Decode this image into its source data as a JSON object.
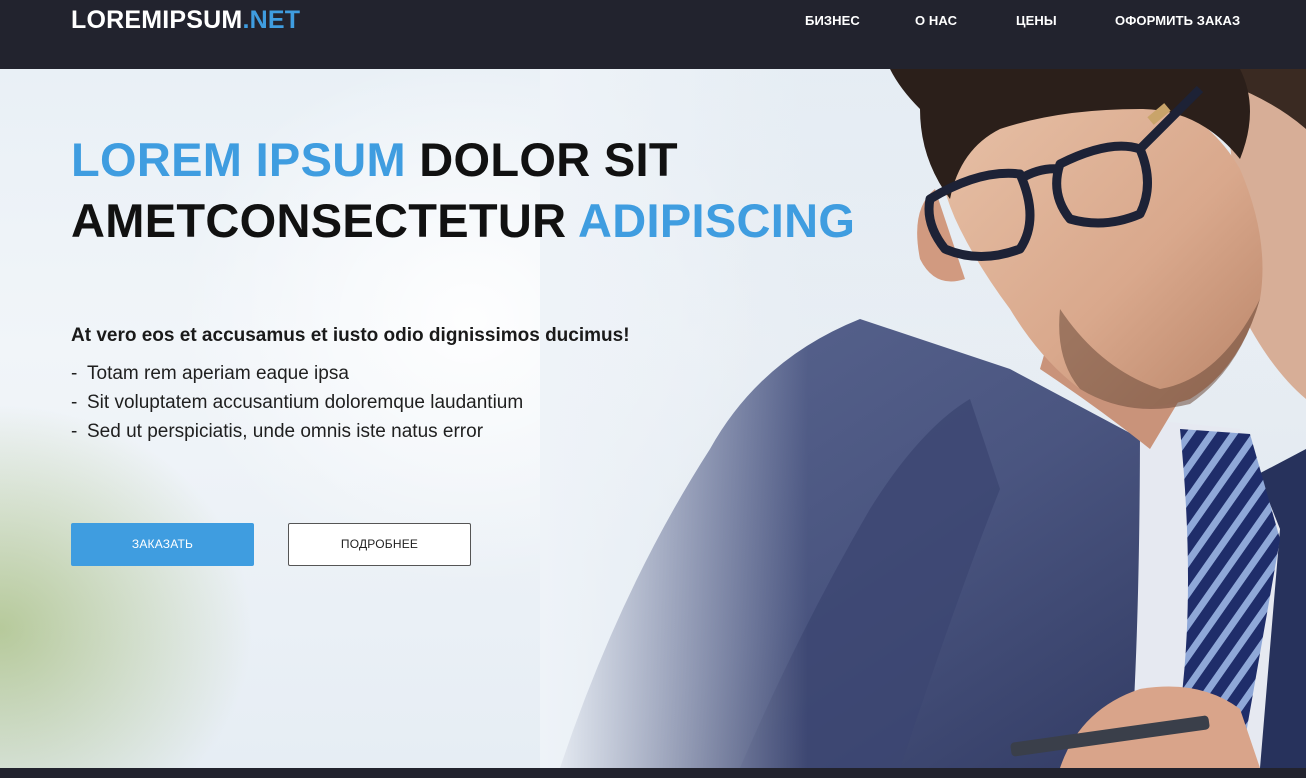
{
  "header": {
    "logo_main": "LOREMIPSUM",
    "logo_accent": ".NET",
    "nav": [
      {
        "label": "БИЗНЕС"
      },
      {
        "label": "О НАС"
      },
      {
        "label": "ЦЕНЫ"
      },
      {
        "label": "ОФОРМИТЬ ЗАКАЗ"
      }
    ]
  },
  "hero": {
    "title": {
      "part1_blue": "LOREM IPSUM",
      "part2": "DOLOR SIT",
      "part3": "AMETCONSECTETUR",
      "part4_blue": "ADIPISCING"
    },
    "subtitle": "At vero eos et accusamus et iusto odio dignissimos ducimus!",
    "features": [
      "Totam rem aperiam eaque ipsa",
      "Sit voluptatem accusantium doloremque laudantium",
      "Sed ut perspiciatis, unde omnis iste natus error"
    ],
    "bullet": "-",
    "buttons": {
      "primary": "ЗАКАЗАТЬ",
      "secondary": "ПОДРОБНЕЕ"
    }
  },
  "colors": {
    "accent": "#3f9de0",
    "header_bg": "#22232e",
    "text_dark": "#111111"
  }
}
